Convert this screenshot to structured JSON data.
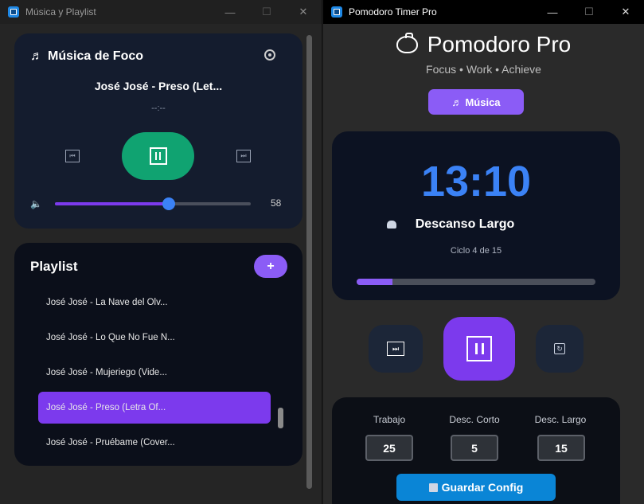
{
  "left_window": {
    "title": "Música y Playlist",
    "music": {
      "title": "Música de Foco",
      "song": "José José - Preso (Let...",
      "time": "--:--",
      "volume": 58,
      "volume_label": "58"
    },
    "playlist": {
      "title": "Playlist",
      "add_label": "+",
      "items": [
        {
          "label": "José José - La Nave del Olv..."
        },
        {
          "label": "José José - Lo Que No Fue N..."
        },
        {
          "label": "José José - Mujeriego (Vide..."
        },
        {
          "label": "José José - Preso (Letra Of..."
        },
        {
          "label": "José José - Pruébame (Cover..."
        }
      ],
      "active_index": 3
    }
  },
  "right_window": {
    "title": "Pomodoro Timer Pro",
    "app_title": "Pomodoro Pro",
    "tagline": "Focus • Work • Achieve",
    "music_button": "Música",
    "timer": "13:10",
    "phase": "Descanso Largo",
    "cycle": "Ciclo 4 de 15",
    "progress_percent": 15,
    "config": {
      "work_label": "Trabajo",
      "work_value": "25",
      "short_label": "Desc. Corto",
      "short_value": "5",
      "long_label": "Desc. Largo",
      "long_value": "15",
      "save_label": "Guardar Config"
    }
  },
  "colors": {
    "accent": "#8b5cf6",
    "timer_blue": "#3b82f6",
    "play_green": "#10a371",
    "save_blue": "#0a85d6"
  }
}
